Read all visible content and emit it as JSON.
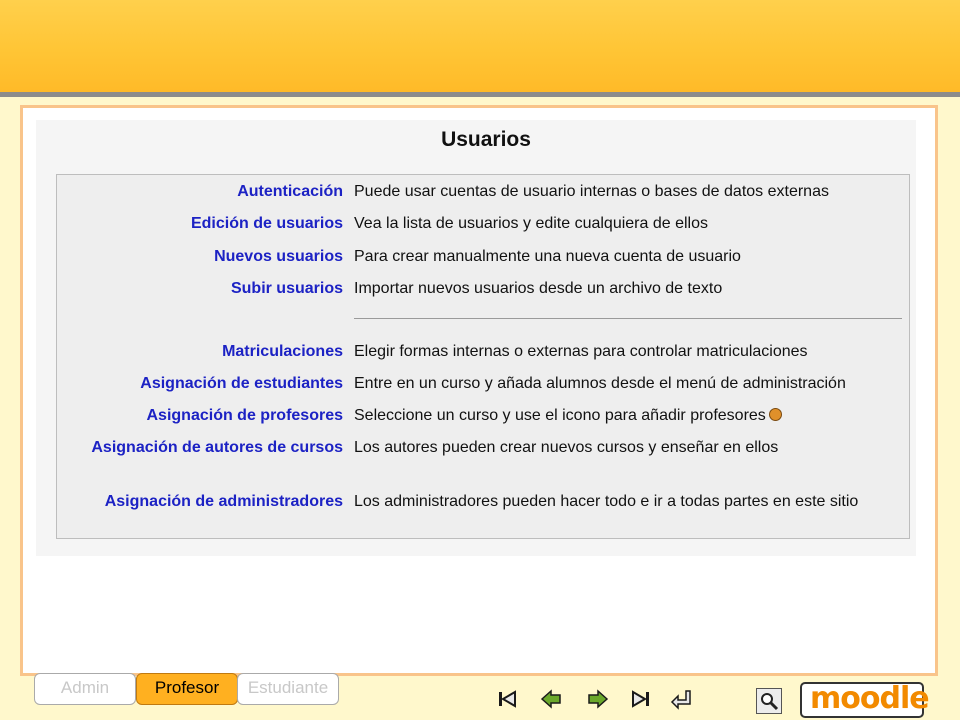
{
  "page_title": "Usuarios",
  "rows": [
    {
      "label": "Autenticación",
      "desc": "Puede usar cuentas de usuario internas o bases de datos externas"
    },
    {
      "label": "Edición de usuarios",
      "desc": "Vea la lista de usuarios y edite cualquiera de ellos"
    },
    {
      "label": "Nuevos usuarios",
      "desc": "Para crear manualmente una nueva cuenta de usuario"
    },
    {
      "label": "Subir usuarios",
      "desc": "Importar nuevos usuarios desde un archivo de texto"
    },
    {
      "label": "Matriculaciones",
      "desc": "Elegir formas internas o externas para controlar matriculaciones"
    },
    {
      "label": "Asignación de estudiantes",
      "desc": "Entre en un curso y añada alumnos desde el menú de administración"
    },
    {
      "label": "Asignación de profesores",
      "desc": "Seleccione un curso y use el icono para añadir profesores"
    },
    {
      "label": "Asignación de autores de cursos",
      "desc": "Los autores pueden crear nuevos cursos y enseñar en ellos"
    },
    {
      "label": "Asignación de administradores",
      "desc": "Los administradores pueden hacer todo e ir a todas partes en este sitio"
    }
  ],
  "tabs": {
    "admin": "Admin",
    "profesor": "Profesor",
    "estudiante": "Estudiante"
  },
  "logo": {
    "text": "moodle",
    "color": "#f28a00"
  },
  "nav_icons": [
    "first-icon",
    "previous-icon",
    "next-icon",
    "last-icon",
    "return-icon"
  ],
  "colors": {
    "header": "#ffc535",
    "link": "#1c22c4",
    "frame_border": "#f9c48a",
    "active_tab": "#ffb020"
  }
}
